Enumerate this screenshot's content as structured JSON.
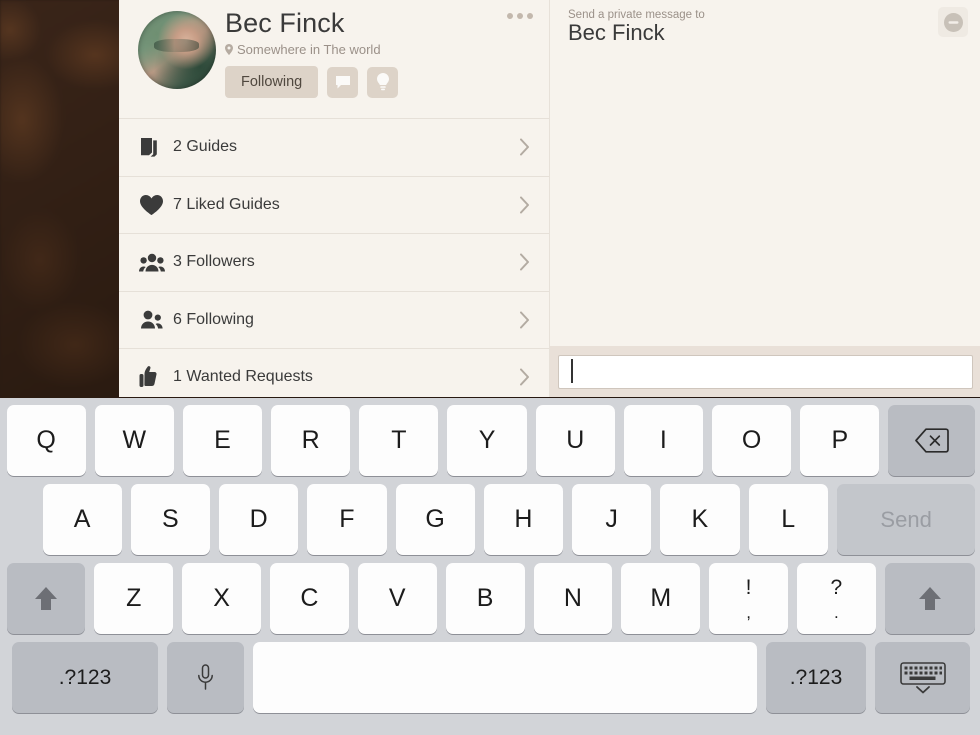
{
  "profile": {
    "name": "Bec Finck",
    "location": "Somewhere in The world",
    "location_icon": "location-pin-icon",
    "following_label": "Following",
    "message_icon": "speech-bubble-icon",
    "idea_icon": "lightbulb-icon",
    "overflow_icon": "more-options-icon",
    "avatar_icon": "user-avatar-photo",
    "items": [
      {
        "label": "2 Guides",
        "icon": "guides-stack-icon",
        "chevron": "chevron-right-icon"
      },
      {
        "label": "7 Liked Guides",
        "icon": "heart-icon",
        "chevron": "chevron-right-icon"
      },
      {
        "label": "3 Followers",
        "icon": "followers-group-icon",
        "chevron": "chevron-right-icon"
      },
      {
        "label": "6 Following",
        "icon": "following-group-icon",
        "chevron": "chevron-right-icon"
      },
      {
        "label": "1 Wanted Requests",
        "icon": "thumbs-up-icon",
        "chevron": "chevron-right-icon"
      }
    ]
  },
  "message": {
    "prompt": "Send a private message to",
    "recipient": "Bec Finck",
    "block_icon": "block-minus-icon",
    "input_value": "",
    "input_placeholder": ""
  },
  "keyboard": {
    "row1": [
      "Q",
      "W",
      "E",
      "R",
      "T",
      "Y",
      "U",
      "I",
      "O",
      "P"
    ],
    "row2": [
      "A",
      "S",
      "D",
      "F",
      "G",
      "H",
      "J",
      "K",
      "L"
    ],
    "row3": [
      "Z",
      "X",
      "C",
      "V",
      "B",
      "N",
      "M"
    ],
    "backspace_icon": "backspace-delete-icon",
    "send_label": "Send",
    "shift_left_icon": "shift-arrow-icon",
    "shift_right_icon": "shift-arrow-icon",
    "punct_excl_top": "!",
    "punct_excl_bot": ",",
    "punct_quest_top": "?",
    "punct_quest_bot": ".",
    "numeric_left_label": ".?123",
    "numeric_right_label": ".?123",
    "mic_icon": "microphone-icon",
    "space_label": "",
    "hide_keyboard_icon": "hide-keyboard-icon"
  },
  "colors": {
    "card_bg": "#f7f3ed",
    "keyboard_bg": "#d2d4d8",
    "key_bg": "#fdfdfd",
    "key_grey": "#b9bcc2",
    "accent_button": "#ddd3c8",
    "text_primary": "#3a3a3a",
    "text_muted": "#9b9189",
    "backdrop": "#2b1b11"
  }
}
